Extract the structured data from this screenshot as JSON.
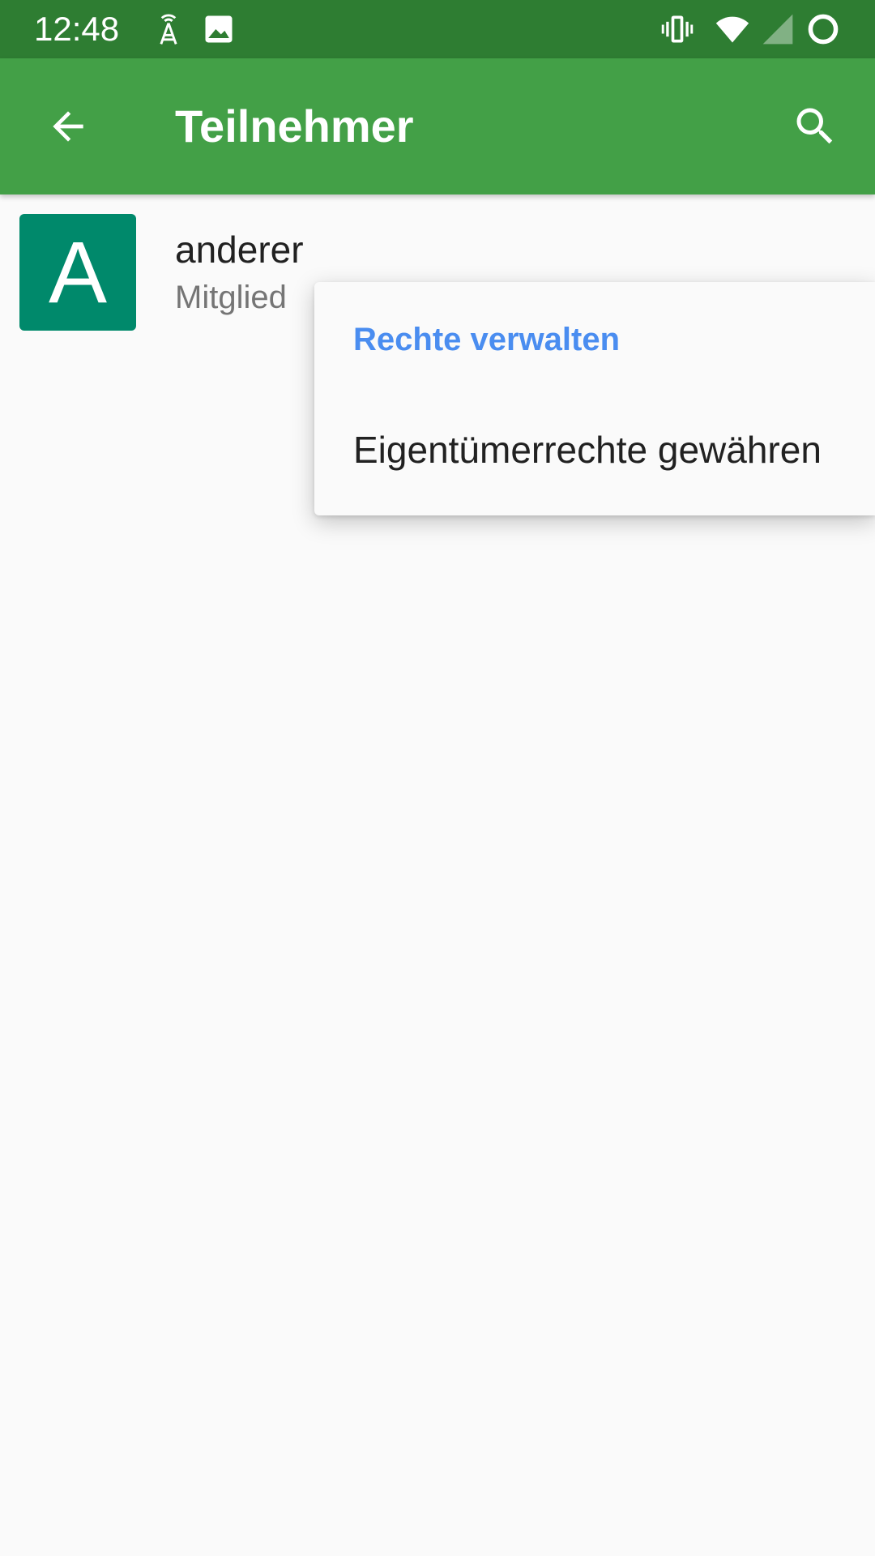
{
  "status_bar": {
    "time": "12:48",
    "icons": [
      "signal-tower-icon",
      "image-icon",
      "vibrate-icon",
      "wifi-icon",
      "cell-signal-icon",
      "loading-ring-icon"
    ]
  },
  "app_bar": {
    "title": "Teilnehmer",
    "back_icon": "arrow-back-icon",
    "search_icon": "search-icon",
    "color": "#43a047",
    "status_color": "#2e7d32"
  },
  "participants": [
    {
      "avatar_letter": "A",
      "avatar_color": "#00896b",
      "name": "anderer",
      "role": "Mitglied"
    }
  ],
  "popup_menu": {
    "header": "Rechte verwalten",
    "header_color": "#4a8df0",
    "items": [
      {
        "label": "Eigentümerrechte gewähren"
      }
    ]
  }
}
